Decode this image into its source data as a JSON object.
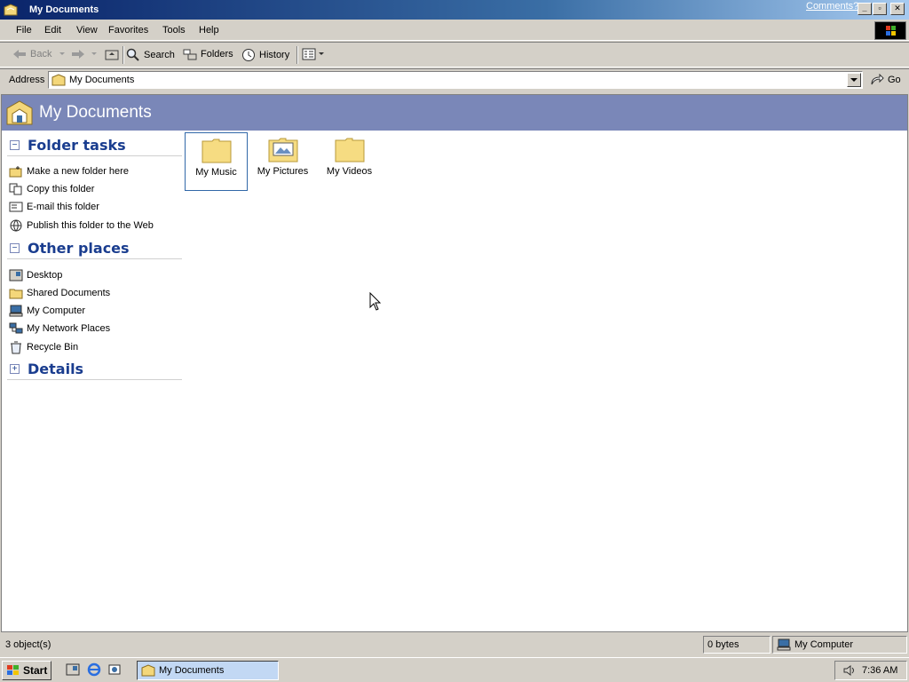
{
  "window": {
    "title": "My Documents",
    "comments_link": "Comments?",
    "minimize": "_",
    "maximize": "▫",
    "close": "✕"
  },
  "menu": {
    "items": [
      "File",
      "Edit",
      "View",
      "Favorites",
      "Tools",
      "Help"
    ]
  },
  "toolbar": {
    "back": "Back",
    "search": "Search",
    "folders": "Folders",
    "history": "History"
  },
  "address": {
    "label": "Address",
    "value": "My Documents",
    "go": "Go"
  },
  "banner": {
    "title": "My Documents"
  },
  "folder_tasks": {
    "title": "Folder tasks",
    "collapse_symbol": "−",
    "items": [
      {
        "label": "Make a new folder here",
        "icon": "new-folder-icon"
      },
      {
        "label": "Copy this folder",
        "icon": "copy-icon"
      },
      {
        "label": "E-mail this folder",
        "icon": "email-icon"
      },
      {
        "label": "Publish this folder to the Web",
        "icon": "web-publish-icon"
      }
    ]
  },
  "other_places": {
    "title": "Other places",
    "collapse_symbol": "−",
    "items": [
      {
        "label": "Desktop",
        "icon": "desktop-icon"
      },
      {
        "label": "Shared Documents",
        "icon": "folder-icon"
      },
      {
        "label": "My Computer",
        "icon": "computer-icon"
      },
      {
        "label": "My Network Places",
        "icon": "network-icon"
      },
      {
        "label": "Recycle Bin",
        "icon": "recycle-bin-icon"
      }
    ]
  },
  "details": {
    "title": "Details",
    "expand_symbol": "+"
  },
  "folders": [
    {
      "label": "My Music",
      "selected": true
    },
    {
      "label": "My Pictures",
      "selected": false
    },
    {
      "label": "My Videos",
      "selected": false
    }
  ],
  "status": {
    "objects": "3 object(s)",
    "size": "0 bytes",
    "location": "My Computer"
  },
  "taskbar": {
    "start": "Start",
    "task_label": "My Documents",
    "clock": "7:36 AM"
  },
  "colors": {
    "banner": "#7a87b8",
    "section_title": "#1a3d8f",
    "selection_border": "#3168a8"
  }
}
